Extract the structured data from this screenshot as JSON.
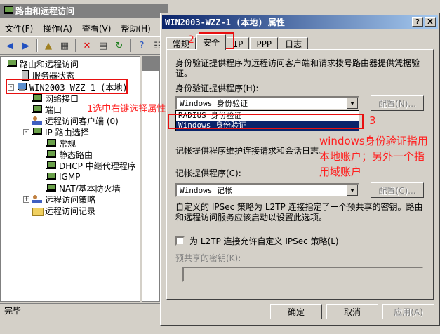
{
  "mmc": {
    "title": "路由和远程访问",
    "menu": [
      "文件(F)",
      "操作(A)",
      "查看(V)",
      "帮助(H)"
    ],
    "tree": {
      "root": "路由和远程访问",
      "server_status": "服务器状态",
      "server": "WIN2003-WZZ-1 (本地)",
      "network_interfaces": "网络接口",
      "ports": "端口",
      "remote_clients": "远程访问客户端 (0)",
      "ip_routing": "IP 路由选择",
      "general": "常规",
      "static_routes": "静态路由",
      "dhcp_relay": "DHCP 中继代理程序",
      "igmp": "IGMP",
      "nat": "NAT/基本防火墙",
      "remote_policies": "远程访问策略",
      "remote_logging": "远程访问记录"
    },
    "status": "完毕"
  },
  "dialog": {
    "title": "WIN2003-WZZ-1 (本地) 属性",
    "help_btn": "?",
    "close_btn": "X",
    "tabs": [
      "常规",
      "安全",
      "IP",
      "PPP",
      "日志"
    ],
    "auth_desc": "身份验证提供程序为远程访问客户端和请求拨号路由器提供凭据验证。",
    "auth_label": "身份验证提供程序(H):",
    "auth_value": "Windows 身份验证",
    "auth_options": [
      "RADIUS 身份验证",
      "Windows 身份验证"
    ],
    "config_btn": "配置(N)...",
    "acct_desc": "记帐提供程序维护连接请求和会话日志。",
    "acct_label": "记帐提供程序(C):",
    "acct_value": "Windows 记帐",
    "config_btn2": "配置(C)...",
    "ipsec_desc": "自定义的 IPSec 策略为 L2TP 连接指定了一个预共享的密钥。路由和远程访问服务应该启动以设置此选项。",
    "ipsec_checkbox": "为 L2TP 连接允许自定义 IPSec 策略(L)",
    "preshared_label": "预共享的密钥(K):",
    "ok": "确定",
    "cancel": "取消",
    "apply": "应用(A)"
  },
  "annotations": {
    "step1": "1选中右键选择属性",
    "step2": "2",
    "step3": "3",
    "note_line1": "windows身份验证指用",
    "note_line2": "本地账户；另外一个指",
    "note_line3": "用域账户"
  }
}
